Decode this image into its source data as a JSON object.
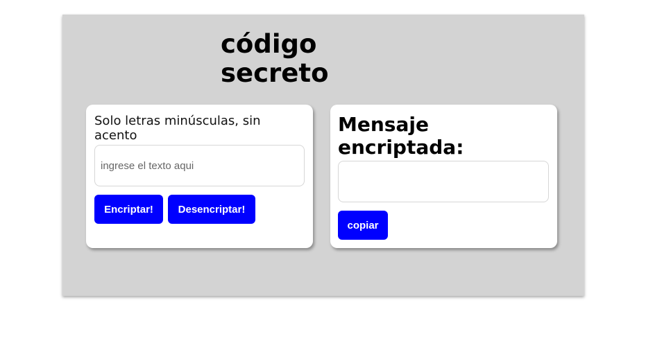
{
  "header": {
    "title": "código\nsecreto"
  },
  "input_panel": {
    "instruction": "Solo letras minúsculas, sin acento",
    "input_value": "",
    "input_placeholder": "ingrese el texto aqui",
    "encrypt_label": "Encriptar!",
    "decrypt_label": "Desencriptar!"
  },
  "output_panel": {
    "title": "Mensaje encriptada:",
    "output_value": "",
    "copy_label": "copiar"
  },
  "colors": {
    "background": "#d3d3d3",
    "card": "#ffffff",
    "button": "#0000ff",
    "button_text": "#ffffff"
  }
}
